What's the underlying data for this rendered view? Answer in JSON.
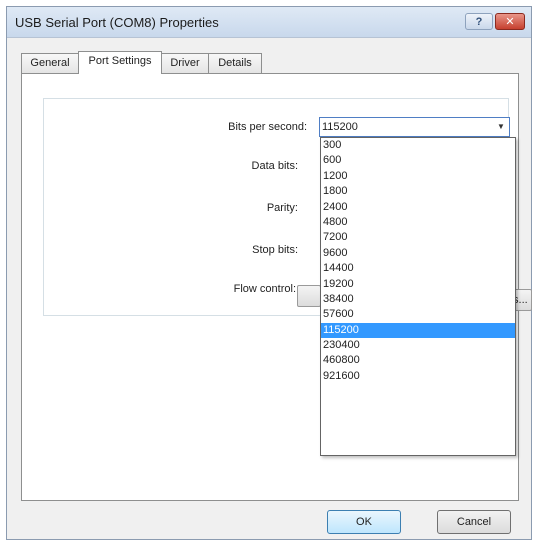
{
  "window": {
    "title": "USB Serial Port (COM8) Properties"
  },
  "titlebar": {
    "help": "?",
    "close": "✕"
  },
  "tabs": [
    {
      "label": "General"
    },
    {
      "label": "Port Settings"
    },
    {
      "label": "Driver"
    },
    {
      "label": "Details"
    }
  ],
  "settings": {
    "bits_per_second_label": "Bits per second:",
    "data_bits_label": "Data bits:",
    "parity_label": "Parity:",
    "stop_bits_label": "Stop bits:",
    "flow_control_label": "Flow control:",
    "bits_per_second_value": "115200",
    "partially_hidden_button_tail": "ts..."
  },
  "dropdown": {
    "options": [
      "300",
      "600",
      "1200",
      "1800",
      "2400",
      "4800",
      "7200",
      "9600",
      "14400",
      "19200",
      "38400",
      "57600",
      "115200",
      "230400",
      "460800",
      "921600"
    ],
    "selected_index": 12
  },
  "footer": {
    "ok": "OK",
    "cancel": "Cancel"
  },
  "colors": {
    "selection": "#3399ff",
    "combo_border": "#4f7ec4",
    "close_button": "#c6402f"
  }
}
